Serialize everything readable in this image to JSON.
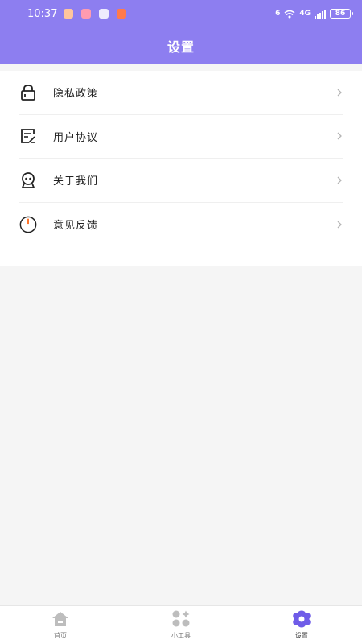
{
  "status_bar": {
    "time": "10:37",
    "network_label": "4G",
    "wifi_label": "6",
    "battery_level": "86"
  },
  "header": {
    "title": "设置"
  },
  "menu": {
    "items": [
      {
        "label": "隐私政策",
        "icon": "lock-icon"
      },
      {
        "label": "用户协议",
        "icon": "document-edit-icon"
      },
      {
        "label": "关于我们",
        "icon": "info-badge-icon"
      },
      {
        "label": "意见反馈",
        "icon": "power-icon"
      }
    ]
  },
  "tabbar": {
    "tabs": [
      {
        "label": "首页",
        "icon": "home-icon"
      },
      {
        "label": "小工具",
        "icon": "apps-icon"
      },
      {
        "label": "设置",
        "icon": "flower-settings-icon"
      }
    ],
    "active_index": 2
  },
  "colors": {
    "header_bg": "#8d7ef0",
    "active_tab": "#6f5ce8",
    "inactive_tab": "#bdbdbd",
    "page_bg": "#f5f5f5"
  }
}
